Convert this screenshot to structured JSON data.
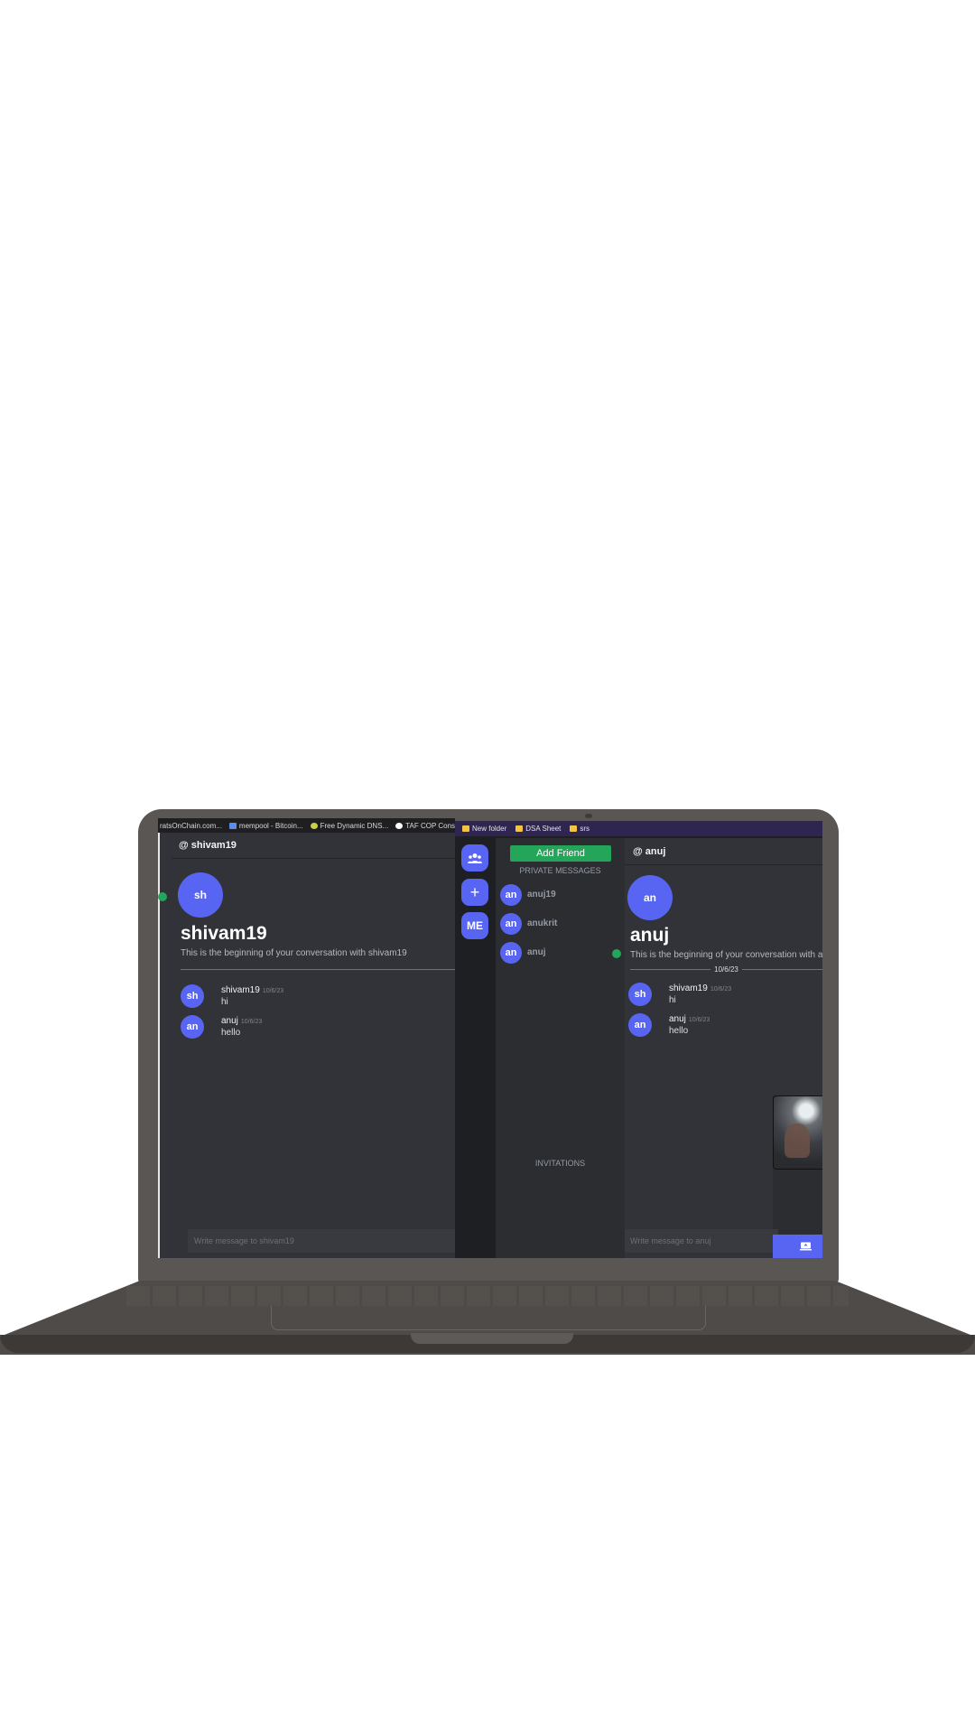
{
  "left_window": {
    "bookmarks": [
      {
        "label": "ratsOnChain.com...",
        "icon": "bookmark-page-icon",
        "color": "#e3e3e3"
      },
      {
        "label": "mempool - Bitcoin...",
        "icon": "mempool-icon",
        "color": "#5a8dee"
      },
      {
        "label": "Free Dynamic DNS...",
        "icon": "dns-icon",
        "color": "#c9d04a"
      },
      {
        "label": "TAF COP Consum...",
        "icon": "globe-icon",
        "color": "#ffffff"
      }
    ],
    "header": "@ shivam19",
    "avatar": "sh",
    "title": "shivam19",
    "subtitle": "This is the beginning of your conversation with shivam19",
    "messages": [
      {
        "avatar": "sh",
        "author": "shivam19",
        "time": "10/6/23",
        "text": "hi"
      },
      {
        "avatar": "an",
        "author": "anuj",
        "time": "10/6/23",
        "text": "hello"
      }
    ],
    "input_placeholder": "Write message to shivam19"
  },
  "right_window": {
    "bookmarks": [
      {
        "label": "New folder",
        "icon": "folder-icon"
      },
      {
        "label": "DSA Sheet",
        "icon": "folder-icon"
      },
      {
        "label": "srs",
        "icon": "folder-icon"
      }
    ],
    "rail": {
      "friends_icon": "people-icon",
      "add_icon": "+",
      "me_label": "ME"
    },
    "dm_panel": {
      "add_friend_label": "Add Friend",
      "section_title": "PRIVATE MESSAGES",
      "items": [
        {
          "avatar": "an",
          "name": "anuj19",
          "online": false
        },
        {
          "avatar": "an",
          "name": "anukrit",
          "online": false
        },
        {
          "avatar": "an",
          "name": "anuj",
          "online": true
        }
      ],
      "invitations_title": "INVITATIONS"
    },
    "chat": {
      "header": "@ anuj",
      "avatar": "an",
      "title": "anuj",
      "subtitle": "This is the beginning of your conversation with a",
      "date_divider": "10/6/23",
      "messages": [
        {
          "avatar": "sh",
          "author": "shivam19",
          "time": "10/6/23",
          "text": "hi"
        },
        {
          "avatar": "an",
          "author": "anuj",
          "time": "10/6/23",
          "text": "hello"
        }
      ],
      "input_placeholder": "Write message to anuj"
    }
  },
  "colors": {
    "accent": "#5865f2",
    "online": "#23a55a",
    "add_friend": "#23a55a",
    "chat_bg": "#313338",
    "sidebar_bg": "#2b2d31",
    "rail_bg": "#1e1f22",
    "laptop": "#5a5653"
  }
}
